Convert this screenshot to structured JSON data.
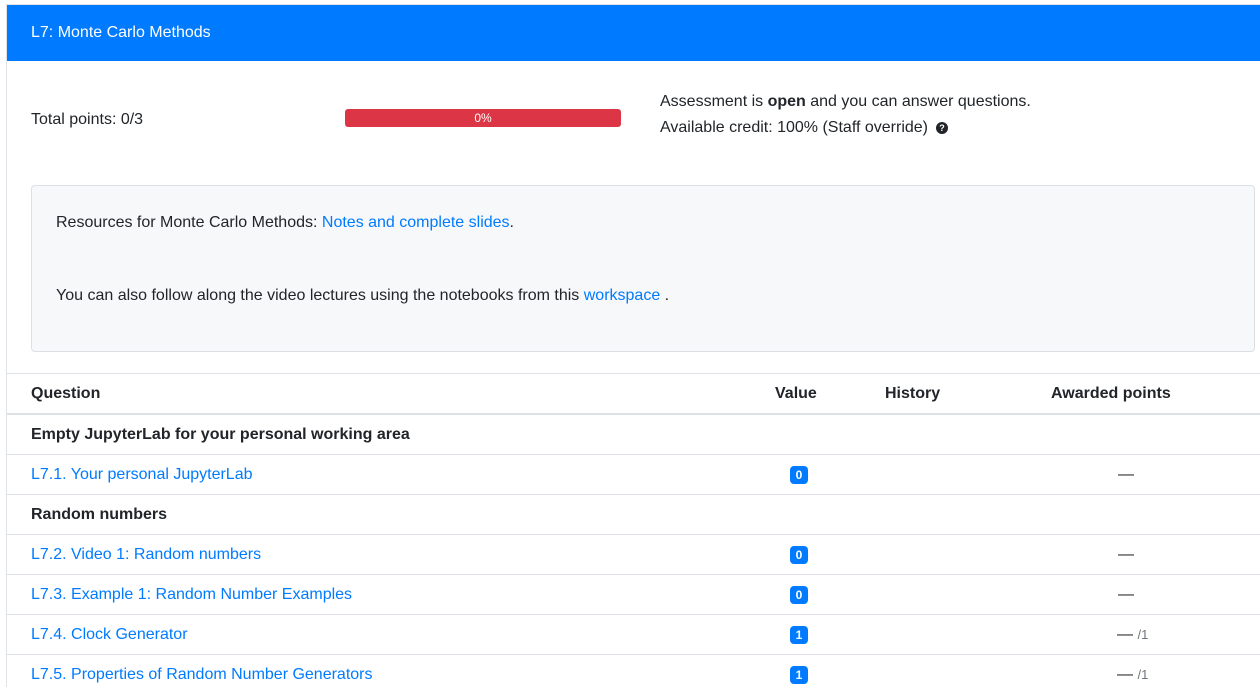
{
  "assessment": {
    "title": "L7: Monte Carlo Methods",
    "total_points_label": "Total points: 0/3",
    "progress": {
      "percent_label": "0%",
      "fraction": 0.0
    },
    "status_prefix": "Assessment is ",
    "status_bold": "open",
    "status_suffix": " and you can answer questions.",
    "credit_label": "Available credit: 100% (Staff override)",
    "help_icon_glyph": "?"
  },
  "resources": {
    "line1_prefix": "Resources for Monte Carlo Methods: ",
    "line1_link": "Notes and complete slides",
    "line1_suffix": ".",
    "line2_prefix": "You can also follow along the video lectures using the notebooks from this ",
    "line2_link": "workspace",
    "line2_suffix": " ."
  },
  "table": {
    "headers": {
      "question": "Question",
      "value": "Value",
      "history": "History",
      "awarded": "Awarded points"
    },
    "rows": [
      {
        "kind": "group",
        "label": "Empty JupyterLab for your personal working area"
      },
      {
        "kind": "question",
        "label": "L7.1. Your personal JupyterLab",
        "value": "0",
        "awarded": "—",
        "max": ""
      },
      {
        "kind": "group",
        "label": "Random numbers"
      },
      {
        "kind": "question",
        "label": "L7.2. Video 1: Random numbers",
        "value": "0",
        "awarded": "—",
        "max": ""
      },
      {
        "kind": "question",
        "label": "L7.3. Example 1: Random Number Examples",
        "value": "0",
        "awarded": "—",
        "max": ""
      },
      {
        "kind": "question",
        "label": "L7.4. Clock Generator",
        "value": "1",
        "awarded": "—",
        "max": "/1"
      },
      {
        "kind": "question",
        "label": "L7.5. Properties of Random Number Generators",
        "value": "1",
        "awarded": "—",
        "max": "/1"
      }
    ]
  },
  "colors": {
    "header_bg": "#007bff",
    "progress_bg": "#dc3545",
    "link": "#007bff",
    "badge_bg": "#007bff"
  }
}
